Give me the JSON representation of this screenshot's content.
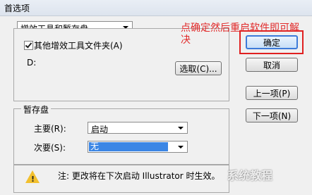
{
  "window": {
    "title": "首选项"
  },
  "category": {
    "selected": "增效工具和暂存盘"
  },
  "plugins": {
    "checkbox_label": "其他增效工具文件夹(A)",
    "checked": true,
    "path": "D:",
    "choose_button": "选取(C)..."
  },
  "scratch": {
    "legend": "暂存盘",
    "primary_label": "主要(R):",
    "primary_value": "启动",
    "secondary_label": "次要(S):",
    "secondary_value": "无"
  },
  "note": "注: 更改将在下次启动 Illustrator 时生效。",
  "buttons": {
    "ok": "确定",
    "cancel": "取消",
    "prev": "上一项(P)",
    "next": "下一项(N)"
  },
  "annotation": "点确定然后重启软件即可解决",
  "watermark": "系统教程",
  "colors": {
    "annotation": "#e12a2a",
    "selection": "#3b86e5"
  }
}
